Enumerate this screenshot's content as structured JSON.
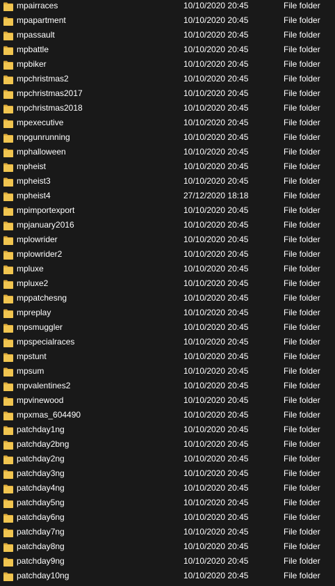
{
  "colors": {
    "background": "#191919",
    "text": "#ffffff",
    "folder_body": "#f1c550",
    "folder_tab": "#dca93a"
  },
  "rows": [
    {
      "name": "mpairraces",
      "date": "10/10/2020 20:45",
      "type": "File folder",
      "icon": "folder-icon"
    },
    {
      "name": "mpapartment",
      "date": "10/10/2020 20:45",
      "type": "File folder",
      "icon": "folder-icon"
    },
    {
      "name": "mpassault",
      "date": "10/10/2020 20:45",
      "type": "File folder",
      "icon": "folder-icon"
    },
    {
      "name": "mpbattle",
      "date": "10/10/2020 20:45",
      "type": "File folder",
      "icon": "folder-icon"
    },
    {
      "name": "mpbiker",
      "date": "10/10/2020 20:45",
      "type": "File folder",
      "icon": "folder-icon"
    },
    {
      "name": "mpchristmas2",
      "date": "10/10/2020 20:45",
      "type": "File folder",
      "icon": "folder-icon"
    },
    {
      "name": "mpchristmas2017",
      "date": "10/10/2020 20:45",
      "type": "File folder",
      "icon": "folder-icon"
    },
    {
      "name": "mpchristmas2018",
      "date": "10/10/2020 20:45",
      "type": "File folder",
      "icon": "folder-icon"
    },
    {
      "name": "mpexecutive",
      "date": "10/10/2020 20:45",
      "type": "File folder",
      "icon": "folder-icon"
    },
    {
      "name": "mpgunrunning",
      "date": "10/10/2020 20:45",
      "type": "File folder",
      "icon": "folder-icon"
    },
    {
      "name": "mphalloween",
      "date": "10/10/2020 20:45",
      "type": "File folder",
      "icon": "folder-icon"
    },
    {
      "name": "mpheist",
      "date": "10/10/2020 20:45",
      "type": "File folder",
      "icon": "folder-icon"
    },
    {
      "name": "mpheist3",
      "date": "10/10/2020 20:45",
      "type": "File folder",
      "icon": "folder-icon"
    },
    {
      "name": "mpheist4",
      "date": "27/12/2020 18:18",
      "type": "File folder",
      "icon": "folder-icon"
    },
    {
      "name": "mpimportexport",
      "date": "10/10/2020 20:45",
      "type": "File folder",
      "icon": "folder-icon"
    },
    {
      "name": "mpjanuary2016",
      "date": "10/10/2020 20:45",
      "type": "File folder",
      "icon": "folder-icon"
    },
    {
      "name": "mplowrider",
      "date": "10/10/2020 20:45",
      "type": "File folder",
      "icon": "folder-icon"
    },
    {
      "name": "mplowrider2",
      "date": "10/10/2020 20:45",
      "type": "File folder",
      "icon": "folder-icon"
    },
    {
      "name": "mpluxe",
      "date": "10/10/2020 20:45",
      "type": "File folder",
      "icon": "folder-icon"
    },
    {
      "name": "mpluxe2",
      "date": "10/10/2020 20:45",
      "type": "File folder",
      "icon": "folder-icon"
    },
    {
      "name": "mppatchesng",
      "date": "10/10/2020 20:45",
      "type": "File folder",
      "icon": "folder-icon"
    },
    {
      "name": "mpreplay",
      "date": "10/10/2020 20:45",
      "type": "File folder",
      "icon": "folder-icon"
    },
    {
      "name": "mpsmuggler",
      "date": "10/10/2020 20:45",
      "type": "File folder",
      "icon": "folder-icon"
    },
    {
      "name": "mpspecialraces",
      "date": "10/10/2020 20:45",
      "type": "File folder",
      "icon": "folder-icon"
    },
    {
      "name": "mpstunt",
      "date": "10/10/2020 20:45",
      "type": "File folder",
      "icon": "folder-icon"
    },
    {
      "name": "mpsum",
      "date": "10/10/2020 20:45",
      "type": "File folder",
      "icon": "folder-icon"
    },
    {
      "name": "mpvalentines2",
      "date": "10/10/2020 20:45",
      "type": "File folder",
      "icon": "folder-icon"
    },
    {
      "name": "mpvinewood",
      "date": "10/10/2020 20:45",
      "type": "File folder",
      "icon": "folder-icon"
    },
    {
      "name": "mpxmas_604490",
      "date": "10/10/2020 20:45",
      "type": "File folder",
      "icon": "folder-icon"
    },
    {
      "name": "patchday1ng",
      "date": "10/10/2020 20:45",
      "type": "File folder",
      "icon": "folder-icon"
    },
    {
      "name": "patchday2bng",
      "date": "10/10/2020 20:45",
      "type": "File folder",
      "icon": "folder-icon"
    },
    {
      "name": "patchday2ng",
      "date": "10/10/2020 20:45",
      "type": "File folder",
      "icon": "folder-icon"
    },
    {
      "name": "patchday3ng",
      "date": "10/10/2020 20:45",
      "type": "File folder",
      "icon": "folder-icon"
    },
    {
      "name": "patchday4ng",
      "date": "10/10/2020 20:45",
      "type": "File folder",
      "icon": "folder-icon"
    },
    {
      "name": "patchday5ng",
      "date": "10/10/2020 20:45",
      "type": "File folder",
      "icon": "folder-icon"
    },
    {
      "name": "patchday6ng",
      "date": "10/10/2020 20:45",
      "type": "File folder",
      "icon": "folder-icon"
    },
    {
      "name": "patchday7ng",
      "date": "10/10/2020 20:45",
      "type": "File folder",
      "icon": "folder-icon"
    },
    {
      "name": "patchday8ng",
      "date": "10/10/2020 20:45",
      "type": "File folder",
      "icon": "folder-icon"
    },
    {
      "name": "patchday9ng",
      "date": "10/10/2020 20:45",
      "type": "File folder",
      "icon": "folder-icon"
    },
    {
      "name": "patchday10ng",
      "date": "10/10/2020 20:45",
      "type": "File folder",
      "icon": "folder-icon"
    }
  ]
}
